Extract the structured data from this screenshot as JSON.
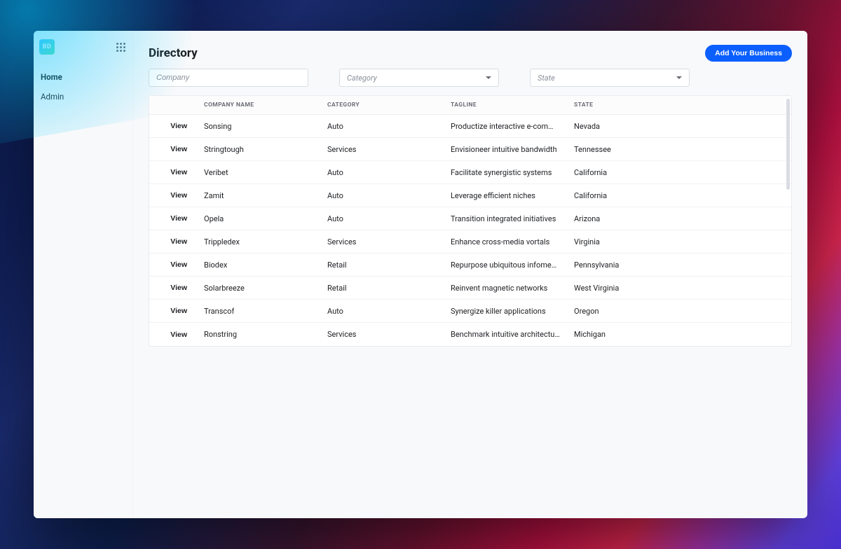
{
  "logo_text": "BD",
  "sidebar": {
    "items": [
      {
        "label": "Home",
        "active": true
      },
      {
        "label": "Admin",
        "active": false
      }
    ]
  },
  "header": {
    "title": "Directory",
    "add_button_label": "Add Your Business"
  },
  "filters": {
    "company_placeholder": "Company",
    "category_placeholder": "Category",
    "state_placeholder": "State"
  },
  "table": {
    "view_label": "View",
    "headers": {
      "company": "COMPANY NAME",
      "category": "CATEGORY",
      "tagline": "TAGLINE",
      "state": "STATE"
    },
    "rows": [
      {
        "company": "Sonsing",
        "category": "Auto",
        "tagline": "Productize interactive e-comme…",
        "state": "Nevada"
      },
      {
        "company": "Stringtough",
        "category": "Services",
        "tagline": "Envisioneer intuitive bandwidth",
        "state": "Tennessee"
      },
      {
        "company": "Veribet",
        "category": "Auto",
        "tagline": "Facilitate synergistic systems",
        "state": "California"
      },
      {
        "company": "Zamit",
        "category": "Auto",
        "tagline": "Leverage efficient niches",
        "state": "California"
      },
      {
        "company": "Opela",
        "category": "Auto",
        "tagline": "Transition integrated initiatives",
        "state": "Arizona"
      },
      {
        "company": "Trippledex",
        "category": "Services",
        "tagline": "Enhance cross-media vortals",
        "state": "Virginia"
      },
      {
        "company": "Biodex",
        "category": "Retail",
        "tagline": "Repurpose ubiquitous infomedi…",
        "state": "Pennsylvania"
      },
      {
        "company": "Solarbreeze",
        "category": "Retail",
        "tagline": "Reinvent magnetic networks",
        "state": "West Virginia"
      },
      {
        "company": "Transcof",
        "category": "Auto",
        "tagline": "Synergize killer applications",
        "state": "Oregon"
      },
      {
        "company": "Ronstring",
        "category": "Services",
        "tagline": "Benchmark intuitive architectures",
        "state": "Michigan"
      }
    ]
  }
}
